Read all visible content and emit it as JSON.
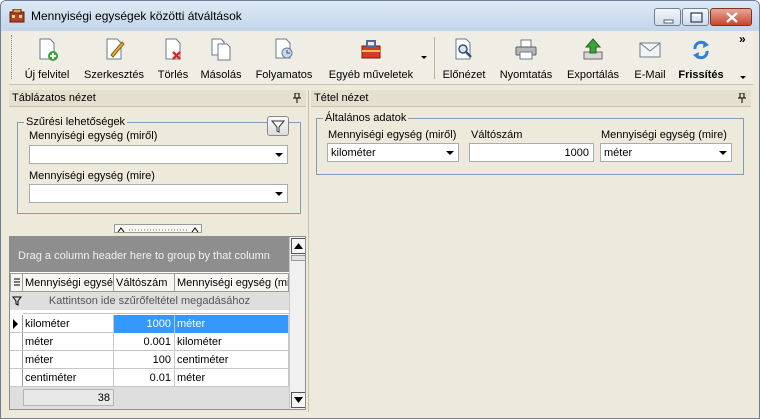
{
  "window": {
    "title": "Mennyiségi egységek közötti átváltások"
  },
  "toolbar": {
    "new": "Új felvitel",
    "edit": "Szerkesztés",
    "delete": "Törlés",
    "copy": "Másolás",
    "continuous": "Folyamatos",
    "other": "Egyéb műveletek",
    "preview": "Előnézet",
    "print": "Nyomtatás",
    "export": "Exportálás",
    "email": "E-Mail",
    "refresh": "Frissítés",
    "overflow": "»"
  },
  "left_pane": {
    "title": "Táblázatos nézet",
    "filter": {
      "title": "Szűrési lehetőségek",
      "from_label": "Mennyiségi egység (miről)",
      "from_value": "",
      "to_label": "Mennyiségi egység (mire)",
      "to_value": ""
    },
    "grid": {
      "group_hint": "Drag a column header here to group by that column",
      "columns": [
        "Mennyiségi egység",
        "Váltószám",
        "Mennyiségi egység (mi"
      ],
      "filter_hint": "Kattintson ide szűrőfeltétel megadásához",
      "rows": [
        {
          "from": "kilométer",
          "factor": "1000",
          "to": "méter"
        },
        {
          "from": "méter",
          "factor": "0.001",
          "to": "kilométer"
        },
        {
          "from": "méter",
          "factor": "100",
          "to": "centiméter"
        },
        {
          "from": "centiméter",
          "factor": "0.01",
          "to": "méter"
        }
      ],
      "count": "38"
    }
  },
  "right_pane": {
    "title": "Tétel nézet",
    "group_title": "Általános adatok",
    "from_label": "Mennyiségi egység (miről)",
    "from_value": "kilométer",
    "factor_label": "Váltószám",
    "factor_value": "1000",
    "to_label": "Mennyiségi egység (mire)",
    "to_value": "méter"
  },
  "colors": {
    "selection": "#3399ff",
    "accent": "#7f9db9"
  }
}
